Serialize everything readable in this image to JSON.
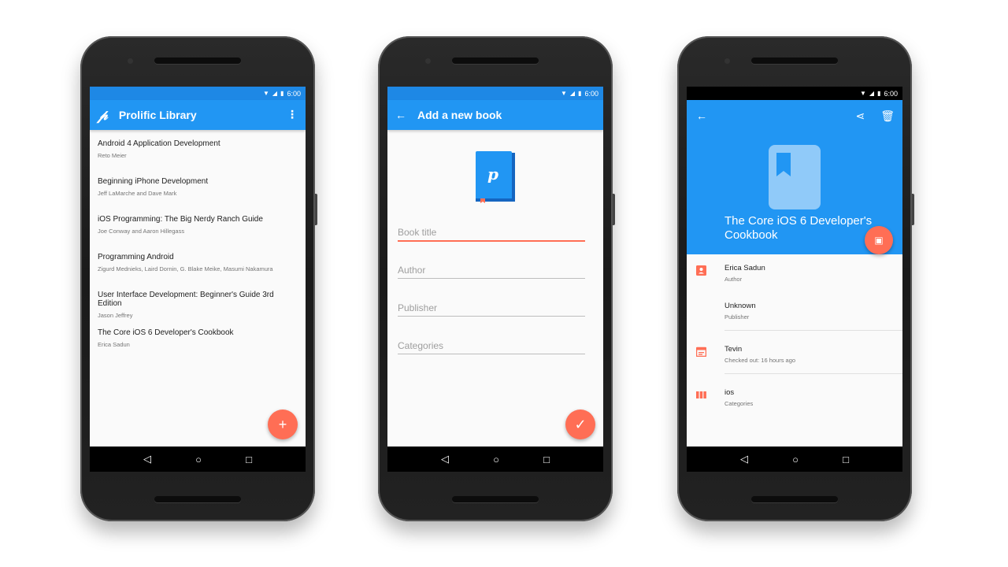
{
  "status": {
    "time": "6:00"
  },
  "screen1": {
    "title": "Prolific Library",
    "menu": "⋮",
    "books": [
      {
        "title": "Android 4 Application Development",
        "author": "Reto Meier"
      },
      {
        "title": "Beginning iPhone Development",
        "author": "Jeff LaMarche and Dave Mark"
      },
      {
        "title": "iOS Programming: The Big Nerdy Ranch Guide",
        "author": "Joe Conway and Aaron Hillegass"
      },
      {
        "title": "Programming Android",
        "author": "Zigurd Mednieks, Laird Dornin, G. Blake Meike, Masumi Nakamura"
      },
      {
        "title": "User Interface Development: Beginner's Guide 3rd Edition",
        "author": "Jason Jeffrey"
      },
      {
        "title": "The Core iOS 6 Developer's Cookbook",
        "author": "Erica Sadun"
      }
    ],
    "fab": "+"
  },
  "screen2": {
    "title": "Add a new book",
    "fields": [
      "Book title",
      "Author",
      "Publisher",
      "Categories"
    ],
    "fab": "✓"
  },
  "screen3": {
    "title": "The Core iOS 6 Developer's Cookbook",
    "rows": [
      {
        "title": "Erica Sadun",
        "sub": "Author",
        "icon": "person-icon"
      },
      {
        "title": "Unknown",
        "sub": "Publisher",
        "icon": ""
      },
      {
        "title": "Tevin",
        "sub": "Checked out: 16 hours ago",
        "icon": "calendar-icon"
      },
      {
        "title": "ios",
        "sub": "Categories",
        "icon": "columns-icon"
      }
    ]
  },
  "colors": {
    "primary": "#2196f3",
    "primary_dark": "#1e88e5",
    "accent": "#ff6e55"
  }
}
